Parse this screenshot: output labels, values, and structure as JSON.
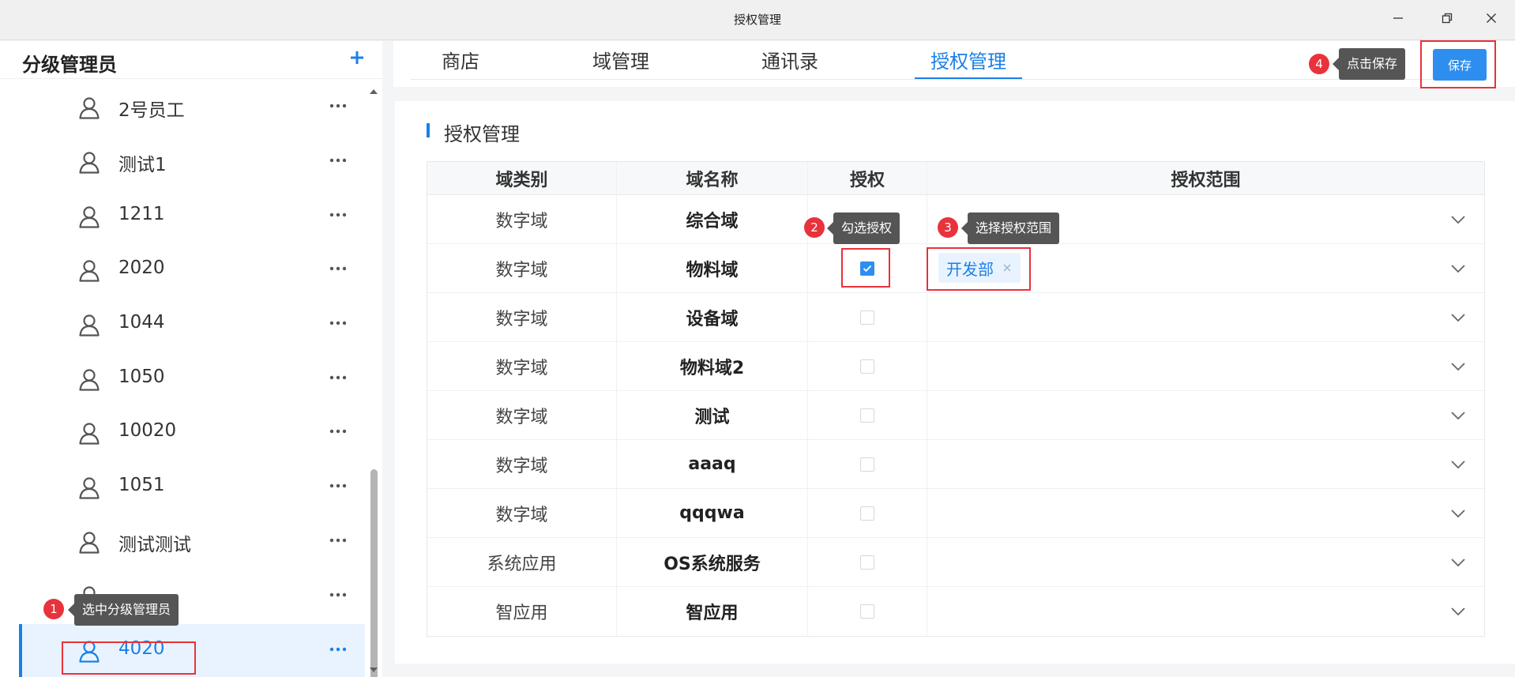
{
  "window": {
    "title": "授权管理"
  },
  "sidebar": {
    "title": "分级管理员",
    "items": [
      {
        "label": "2号员工"
      },
      {
        "label": "测试1"
      },
      {
        "label": "1211"
      },
      {
        "label": "2020"
      },
      {
        "label": "1044"
      },
      {
        "label": "1050"
      },
      {
        "label": "10020"
      },
      {
        "label": "1051"
      },
      {
        "label": "测试测试"
      },
      {
        "label": ""
      },
      {
        "label": "4020",
        "selected": true
      }
    ]
  },
  "tabs": [
    {
      "label": "商店"
    },
    {
      "label": "域管理"
    },
    {
      "label": "通讯录"
    },
    {
      "label": "授权管理",
      "active": true
    }
  ],
  "save_label": "保存",
  "callouts": {
    "step1": {
      "num": "1",
      "text": "选中分级管理员"
    },
    "step2": {
      "num": "2",
      "text": "勾选授权"
    },
    "step3": {
      "num": "3",
      "text": "选择授权范围"
    },
    "step4": {
      "num": "4",
      "text": "点击保存"
    }
  },
  "panel": {
    "title": "授权管理"
  },
  "table": {
    "headers": [
      "域类别",
      "域名称",
      "授权",
      "授权范围"
    ],
    "rows": [
      {
        "category": "数字域",
        "name": "综合域",
        "checked": false,
        "scope": ""
      },
      {
        "category": "数字域",
        "name": "物料域",
        "checked": true,
        "scope": "开发部"
      },
      {
        "category": "数字域",
        "name": "设备域",
        "checked": false,
        "scope": ""
      },
      {
        "category": "数字域",
        "name": "物料域2",
        "checked": false,
        "scope": ""
      },
      {
        "category": "数字域",
        "name": "测试",
        "checked": false,
        "scope": ""
      },
      {
        "category": "数字域",
        "name": "aaaq",
        "checked": false,
        "scope": ""
      },
      {
        "category": "数字域",
        "name": "qqqwa",
        "checked": false,
        "scope": ""
      },
      {
        "category": "系统应用",
        "name": "OS系统服务",
        "checked": false,
        "scope": ""
      },
      {
        "category": "智应用",
        "name": "智应用",
        "checked": false,
        "scope": ""
      }
    ]
  },
  "colors": {
    "accent": "#1a80e6",
    "callout_red": "#e8323c",
    "tooltip_bg": "#555555"
  },
  "icons": {
    "add": "plus-icon",
    "user": "user-icon",
    "more": "more-icon",
    "chevron": "chevron-down-icon",
    "close": "close-icon"
  }
}
